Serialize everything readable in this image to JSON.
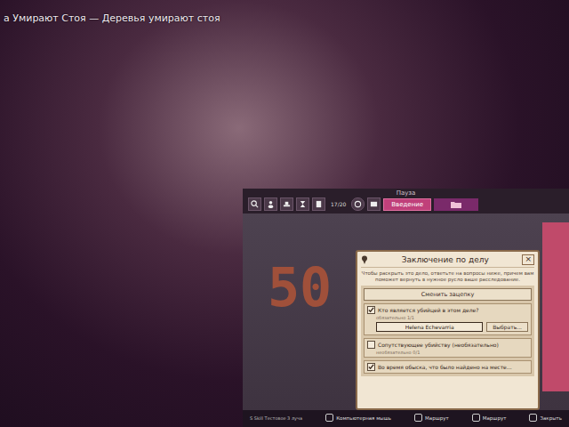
{
  "stream": {
    "ticker": "а Умирают Стоя — Деревья умирают стоя"
  },
  "game": {
    "title": "Пауза",
    "counter": "17/20",
    "intro_tab": "Введение",
    "background_text": "50",
    "dialog": {
      "title": "Заключение по делу",
      "close": "×",
      "intro": "Чтобы раскрыть это дело, ответьте на вопросы ниже, причем вам поможет вернуть в нужное русло ваше расследование.",
      "change_button": "Сменить зацепку",
      "questions": [
        {
          "kind": "answer",
          "checked": true,
          "text": "Кто является убийцей в этом деле?",
          "note": "обязательно 1/1",
          "answer": "Helena Echevarria",
          "choose": "Выбрать..."
        },
        {
          "kind": "plain",
          "checked": false,
          "text": "Сопутствующее убийству (необязательно)",
          "note": "необязательно 0/1"
        },
        {
          "kind": "plain",
          "checked": true,
          "text": "Во время обыска, что было найдено на месте…"
        }
      ]
    },
    "bottom_bar": {
      "footer": "S Skill Тестовое 3 луча",
      "items": [
        {
          "label": "Компьютерная мышь"
        },
        {
          "label": "Маршрут"
        },
        {
          "label": "Маршрут"
        },
        {
          "label": "Закрыть"
        }
      ]
    }
  }
}
